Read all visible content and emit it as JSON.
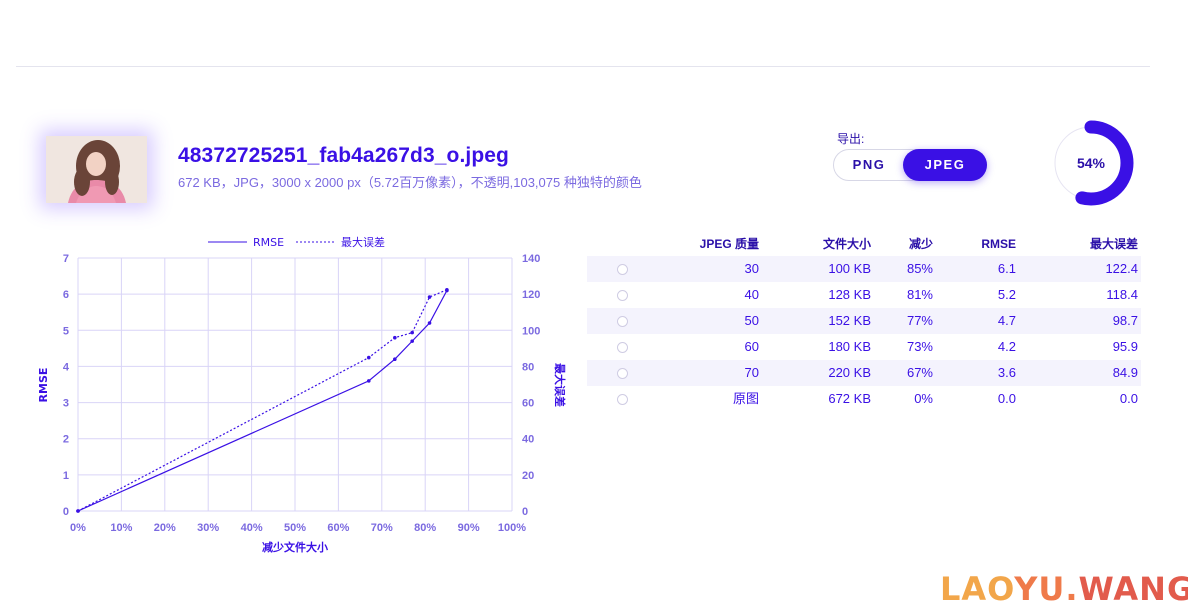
{
  "file": {
    "name": "48372725251_fab4a267d3_o.jpeg",
    "meta": "672 KB，JPG，3000 x 2000 px（5.72百万像素），不透明,103,075 种独特的颜色"
  },
  "export": {
    "label": "导出:",
    "options": [
      "PNG",
      "JPEG"
    ],
    "selected": "JPEG"
  },
  "progress": {
    "value": 54,
    "label": "54%"
  },
  "colors": {
    "accent": "#3a10e5",
    "muted": "#7b6ae0",
    "grid": "#d9d4f7",
    "stripe": "#f4f3fd"
  },
  "table": {
    "headers": [
      "JPEG 质量",
      "文件大小",
      "减少",
      "RMSE",
      "最大误差"
    ],
    "rows": [
      {
        "quality": "30",
        "size": "100 KB",
        "reduction": "85%",
        "rmse": "6.1",
        "max_error": "122.4"
      },
      {
        "quality": "40",
        "size": "128 KB",
        "reduction": "81%",
        "rmse": "5.2",
        "max_error": "118.4"
      },
      {
        "quality": "50",
        "size": "152 KB",
        "reduction": "77%",
        "rmse": "4.7",
        "max_error": "98.7"
      },
      {
        "quality": "60",
        "size": "180 KB",
        "reduction": "73%",
        "rmse": "4.2",
        "max_error": "95.9"
      },
      {
        "quality": "70",
        "size": "220 KB",
        "reduction": "67%",
        "rmse": "3.6",
        "max_error": "84.9"
      },
      {
        "quality": "原图",
        "size": "672 KB",
        "reduction": "0%",
        "rmse": "0.0",
        "max_error": "0.0"
      }
    ]
  },
  "chart_data": {
    "type": "line",
    "xlabel": "减少文件大小",
    "ylabel": "RMSE",
    "y2label": "最大误差",
    "xlim": [
      0,
      100
    ],
    "ylim": [
      0,
      7
    ],
    "y2lim": [
      0,
      140
    ],
    "x_ticks": [
      "0%",
      "10%",
      "20%",
      "30%",
      "40%",
      "50%",
      "60%",
      "70%",
      "80%",
      "90%",
      "100%"
    ],
    "y_ticks": [
      "0",
      "1",
      "2",
      "3",
      "4",
      "5",
      "6",
      "7"
    ],
    "y2_ticks": [
      "0",
      "20",
      "40",
      "60",
      "80",
      "100",
      "120",
      "140"
    ],
    "grid": true,
    "legend": "top",
    "series": [
      {
        "name": "RMSE",
        "axis": "left",
        "style": "solid",
        "points": [
          [
            0,
            0.0
          ],
          [
            67,
            3.6
          ],
          [
            73,
            4.2
          ],
          [
            77,
            4.7
          ],
          [
            81,
            5.2
          ],
          [
            85,
            6.1
          ]
        ]
      },
      {
        "name": "最大误差",
        "axis": "right",
        "style": "dotted",
        "points": [
          [
            0,
            0.0
          ],
          [
            67,
            84.9
          ],
          [
            73,
            95.9
          ],
          [
            77,
            98.7
          ],
          [
            81,
            118.4
          ],
          [
            85,
            122.4
          ]
        ]
      }
    ]
  },
  "watermark": {
    "part1": "LAO",
    "part2": "YU.",
    "part3": "WANG"
  }
}
